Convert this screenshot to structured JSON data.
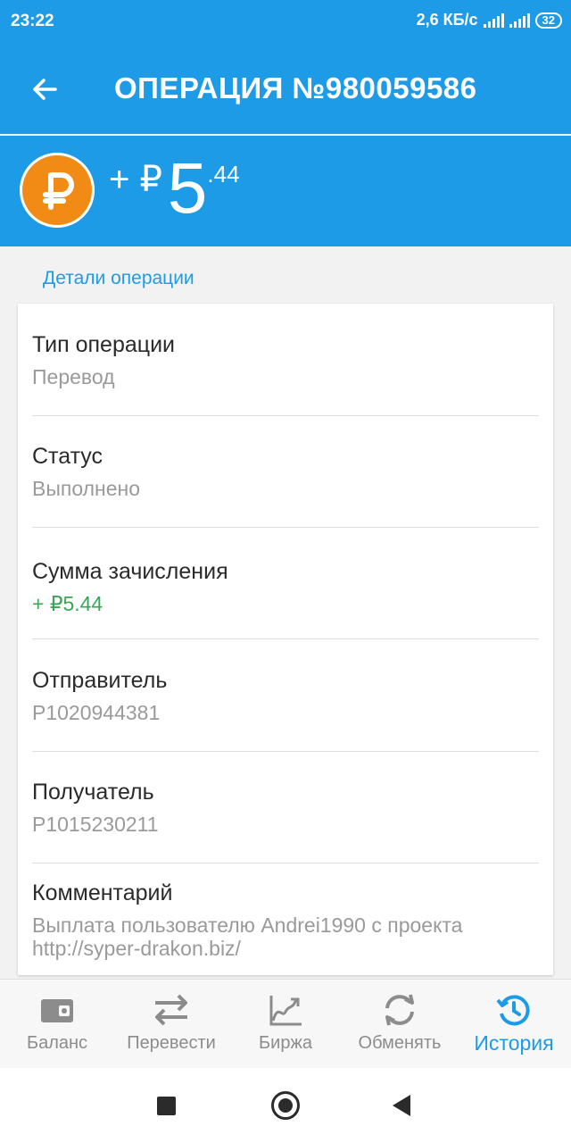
{
  "status_bar": {
    "time": "23:22",
    "speed": "2,6 КБ/с",
    "battery": "32"
  },
  "app_bar": {
    "title": "ОПЕРАЦИЯ №980059586",
    "back_icon": "arrow-left-icon"
  },
  "header": {
    "sign": "+ ₽",
    "amount_main": "5",
    "amount_fraction": ".44",
    "currency_icon": "ruble-coin-icon",
    "coin_color": "#f28b15"
  },
  "section_label": "Детали операции",
  "details": [
    {
      "label": "Тип операции",
      "value": "Перевод"
    },
    {
      "label": "Статус",
      "value": "Выполнено"
    },
    {
      "label": "Сумма зачисления",
      "value": "+ ₽5.44"
    },
    {
      "label": "Отправитель",
      "value": "P1020944381"
    },
    {
      "label": "Получатель",
      "value": "P1015230211"
    },
    {
      "label": "Комментарий",
      "value": "Выплата пользователю Andrei1990 с проекта http://syper-drakon.biz/"
    }
  ],
  "tabs": [
    {
      "label": "Баланс",
      "icon": "wallet-icon",
      "active": false
    },
    {
      "label": "Перевести",
      "icon": "transfer-arrows-icon",
      "active": false
    },
    {
      "label": "Биржа",
      "icon": "chart-icon",
      "active": false
    },
    {
      "label": "Обменять",
      "icon": "exchange-refresh-icon",
      "active": false
    },
    {
      "label": "История",
      "icon": "history-clock-icon",
      "active": true
    }
  ],
  "colors": {
    "primary": "#1e9be7",
    "positive": "#3aa655",
    "inactive_tab": "#8c8c8c"
  }
}
